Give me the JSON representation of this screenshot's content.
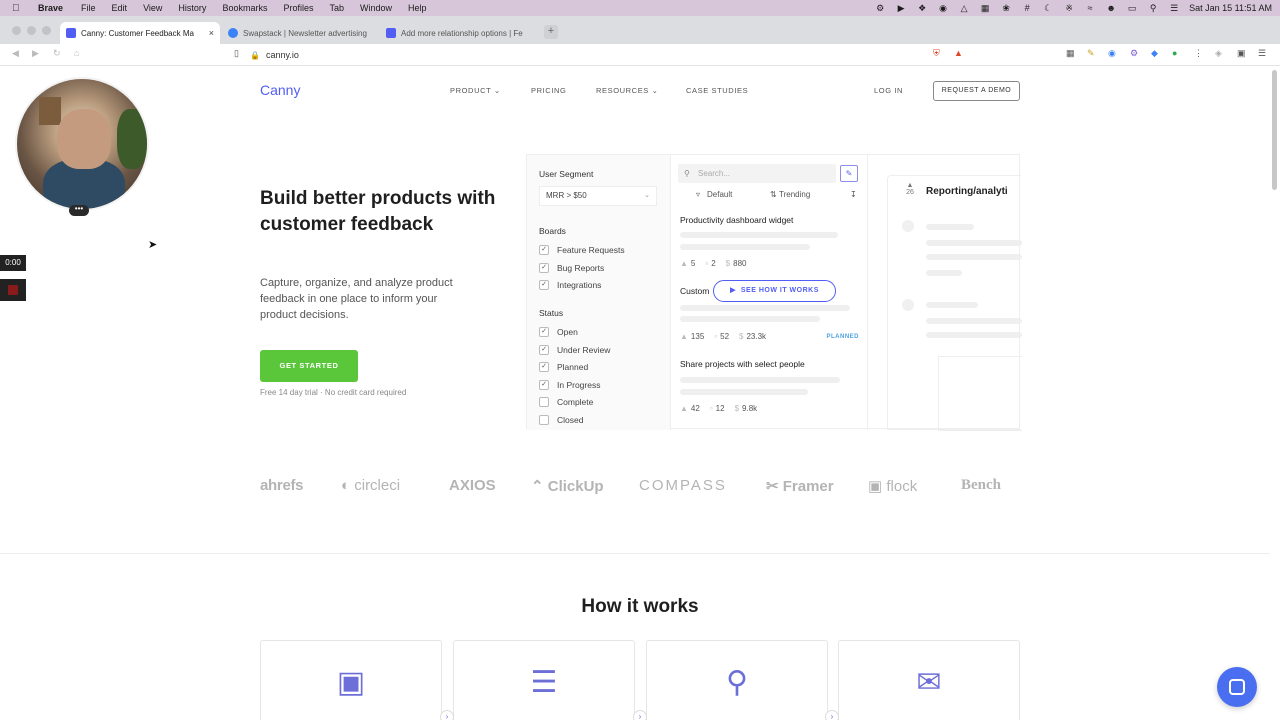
{
  "menubar": {
    "app": "Brave",
    "items": [
      "File",
      "Edit",
      "View",
      "History",
      "Bookmarks",
      "Profiles",
      "Tab",
      "Window",
      "Help"
    ],
    "clock": "Sat Jan 15  11:51 AM"
  },
  "tabs": [
    {
      "title": "Canny: Customer Feedback Ma",
      "color": "#525df4"
    },
    {
      "title": "Swapstack | Newsletter advertising",
      "color": "#3b82f6"
    },
    {
      "title": "Add more relationship options | Fe",
      "color": "#525df4"
    }
  ],
  "address": {
    "url": "canny.io"
  },
  "recorder": {
    "time": "0:00",
    "menu": "•••"
  },
  "site": {
    "logo": "Canny",
    "nav": [
      "PRODUCT",
      "PRICING",
      "RESOURCES",
      "CASE STUDIES"
    ],
    "login": "LOG IN",
    "demo": "REQUEST A DEMO"
  },
  "hero": {
    "headline": "Build better products with customer feedback",
    "sub": "Capture, organize, and analyze product feedback in one place to inform your product decisions.",
    "cta": "GET STARTED",
    "trial": "Free 14 day trial · No credit card required"
  },
  "demo": {
    "segment_label": "User Segment",
    "segment_value": "MRR > $50",
    "boards_label": "Boards",
    "boards": [
      {
        "label": "Feature Requests",
        "checked": true
      },
      {
        "label": "Bug Reports",
        "checked": true
      },
      {
        "label": "Integrations",
        "checked": true
      }
    ],
    "status_label": "Status",
    "statuses": [
      {
        "label": "Open",
        "checked": true
      },
      {
        "label": "Under Review",
        "checked": true
      },
      {
        "label": "Planned",
        "checked": true
      },
      {
        "label": "In Progress",
        "checked": true
      },
      {
        "label": "Complete",
        "checked": false
      },
      {
        "label": "Closed",
        "checked": false
      }
    ],
    "search_placeholder": "Search...",
    "sort_default": "Default",
    "sort_trending": "Trending",
    "posts": [
      {
        "title": "Productivity dashboard widget",
        "votes": "5",
        "comments": "2",
        "mrr": "880",
        "badge": ""
      },
      {
        "title": "Custom",
        "votes": "135",
        "comments": "52",
        "mrr": "23.3k",
        "badge": "PLANNED"
      },
      {
        "title": "Share projects with select people",
        "votes": "42",
        "comments": "12",
        "mrr": "9.8k",
        "badge": ""
      }
    ],
    "see_how": "SEE HOW IT WORKS",
    "detail_votes": "26",
    "detail_title": "Reporting/analyti"
  },
  "logos": [
    "ahrefs",
    "circleci",
    "AXIOS",
    "ClickUp",
    "COMPASS",
    "Framer",
    "flock",
    "Bench"
  ],
  "how": {
    "title": "How it works"
  }
}
